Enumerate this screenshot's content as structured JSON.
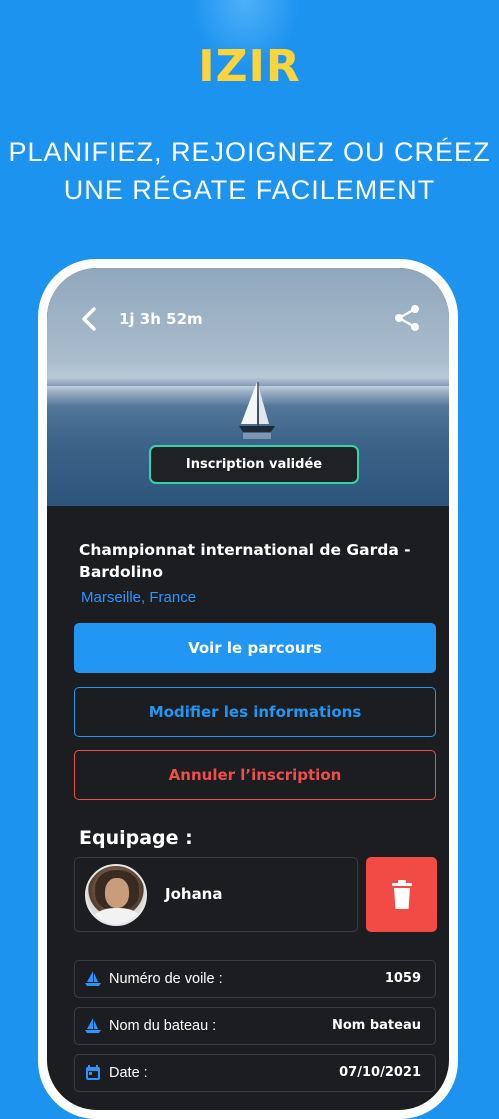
{
  "logo": "IZIR",
  "headline": {
    "line1": "PLANIFIEZ, REJOIGNEZ OU CRÉEZ",
    "line2": "UNE RÉGATE FACILEMENT"
  },
  "event": {
    "countdown": "1j 3h 52m",
    "status_badge": "Inscription validée",
    "title": "Championnat international de Garda - Bardolino",
    "location": "Marseille, France"
  },
  "actions": {
    "view_course": "Voir le parcours",
    "edit_info": "Modifier les informations",
    "cancel_registration": "Annuler l’inscription"
  },
  "crew": {
    "heading": "Equipage :",
    "members": [
      {
        "name": "Johana"
      }
    ]
  },
  "details": [
    {
      "icon": "sailboat-icon",
      "label": "Numéro de voile :",
      "value": "1059"
    },
    {
      "icon": "sailboat-icon",
      "label": "Nom du bateau :",
      "value": "Nom bateau"
    },
    {
      "icon": "calendar-icon",
      "label": "Date :",
      "value": "07/10/2021"
    }
  ],
  "colors": {
    "background": "#1d93f0",
    "accent": "#2196f3",
    "danger": "#ef4f4b",
    "success": "#35d3a8",
    "logo": "#ffd43a"
  }
}
